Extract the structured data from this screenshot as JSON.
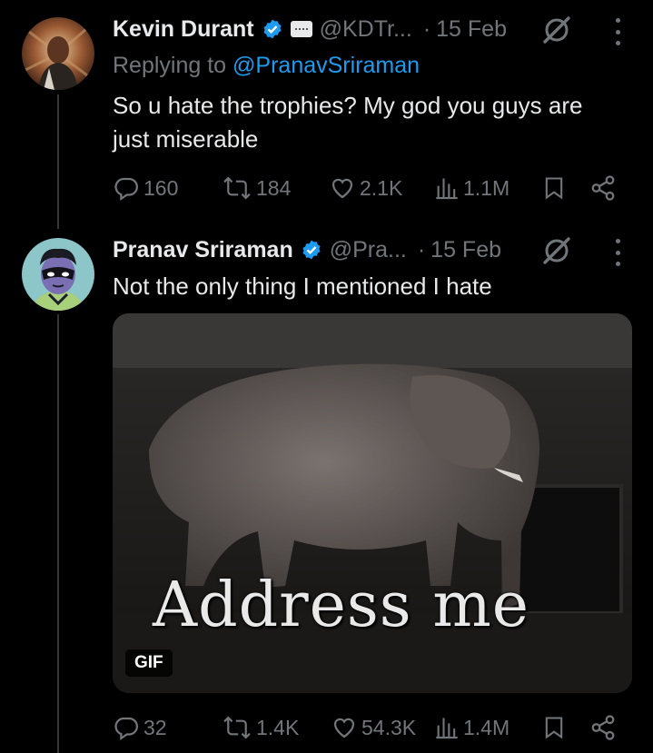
{
  "tweets": [
    {
      "author_name": "Kevin Durant",
      "handle": "@KDTr...",
      "dot": "·",
      "date": "15 Feb",
      "reply_prefix": "Replying to ",
      "reply_handle": "@PranavSriraman",
      "text_line1": "So u hate the trophies? My god you guys are",
      "text_line2": "just miserable",
      "replies": "160",
      "reposts": "184",
      "likes": "2.1K",
      "views": "1.1M",
      "avatar_icon": "profile-photo",
      "affiliation_icon": "affiliation-badge"
    },
    {
      "author_name": "Pranav Sriraman",
      "handle": "@Pra...",
      "dot": "·",
      "date": "15 Feb",
      "text_line1": "Not the only thing I mentioned I hate",
      "media_caption": "Address me",
      "media_badge": "GIF",
      "replies": "32",
      "reposts": "1.4K",
      "likes": "54.3K",
      "views": "1.4M",
      "avatar_icon": "cartoon-avatar"
    }
  ],
  "colors": {
    "background": "#000000",
    "text": "#e7e9ea",
    "muted": "#71767b",
    "accent": "#1d9bf0",
    "verified": "#1d9bf0"
  },
  "icons": [
    "verified-icon",
    "grok-icon",
    "more-icon",
    "reply-icon",
    "repost-icon",
    "like-icon",
    "views-icon",
    "bookmark-icon",
    "share-icon"
  ]
}
